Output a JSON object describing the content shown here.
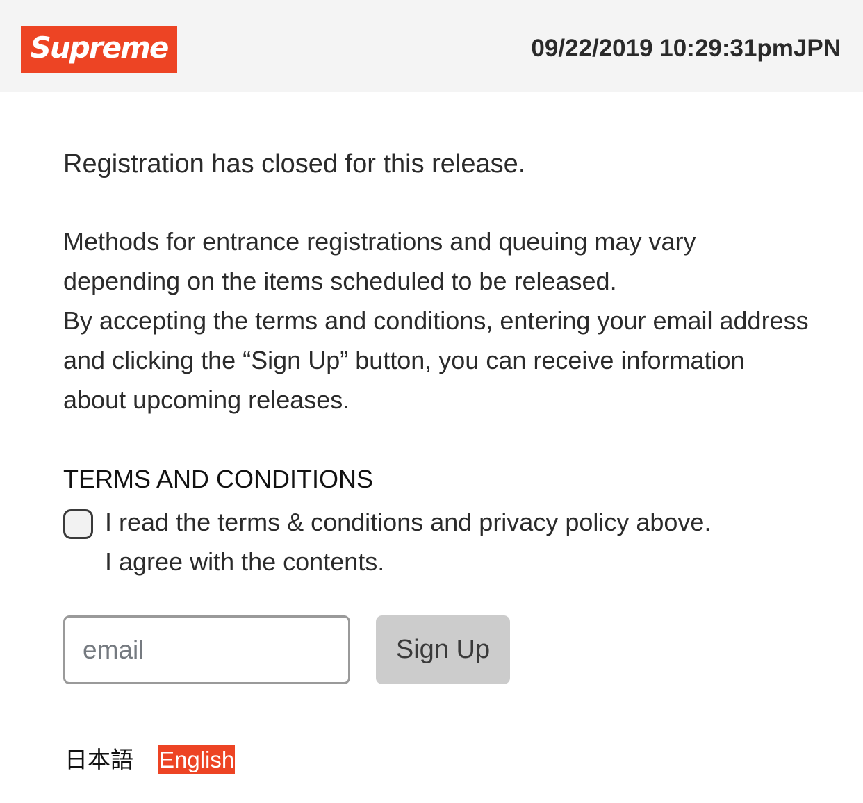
{
  "header": {
    "logo_text": "Supreme",
    "brand_color": "#ed4424",
    "datetime": "09/22/2019 10:29:31pmJPN"
  },
  "main": {
    "closed_message": "Registration has closed for this release.",
    "paragraph_1": "Methods for entrance registrations and queuing may vary depending on the items scheduled to be released.",
    "paragraph_2": "By accepting the terms and conditions, entering your email address and clicking the “Sign Up” button, you can receive information about upcoming releases.",
    "terms_heading": "TERMS AND CONDITIONS",
    "agree_line_1": "I read the terms & conditions and privacy policy above.",
    "agree_line_2": "I agree with the contents.",
    "agree_checked": false,
    "email": {
      "placeholder": "email",
      "value": ""
    },
    "signup_label": "Sign Up"
  },
  "footer": {
    "languages": [
      "日本語",
      "English"
    ],
    "selected_language": "English"
  }
}
